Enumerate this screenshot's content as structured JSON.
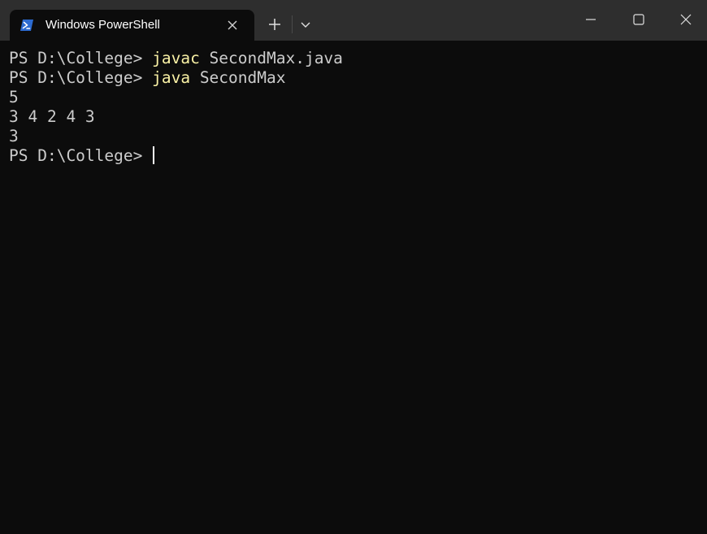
{
  "tab": {
    "icon": "powershell-icon",
    "title": "Windows PowerShell"
  },
  "toolbar": {
    "new_tab_icon": "plus-icon",
    "dropdown_icon": "chevron-down-icon"
  },
  "window_controls": {
    "minimize_icon": "minimize-icon",
    "maximize_icon": "maximize-icon",
    "close_icon": "close-icon"
  },
  "colors": {
    "background": "#0c0c0c",
    "titlebar": "#2e2e2e",
    "foreground": "#cccccc",
    "command": "#f9f1a5"
  },
  "terminal": {
    "lines": [
      {
        "prompt": "PS D:\\College> ",
        "command": "javac",
        "args": " SecondMax.java"
      },
      {
        "prompt": "PS D:\\College> ",
        "command": "java",
        "args": " SecondMax"
      },
      {
        "text": "5"
      },
      {
        "text": "3 4 2 4 3"
      },
      {
        "text": "3"
      },
      {
        "prompt": "PS D:\\College> "
      }
    ]
  }
}
